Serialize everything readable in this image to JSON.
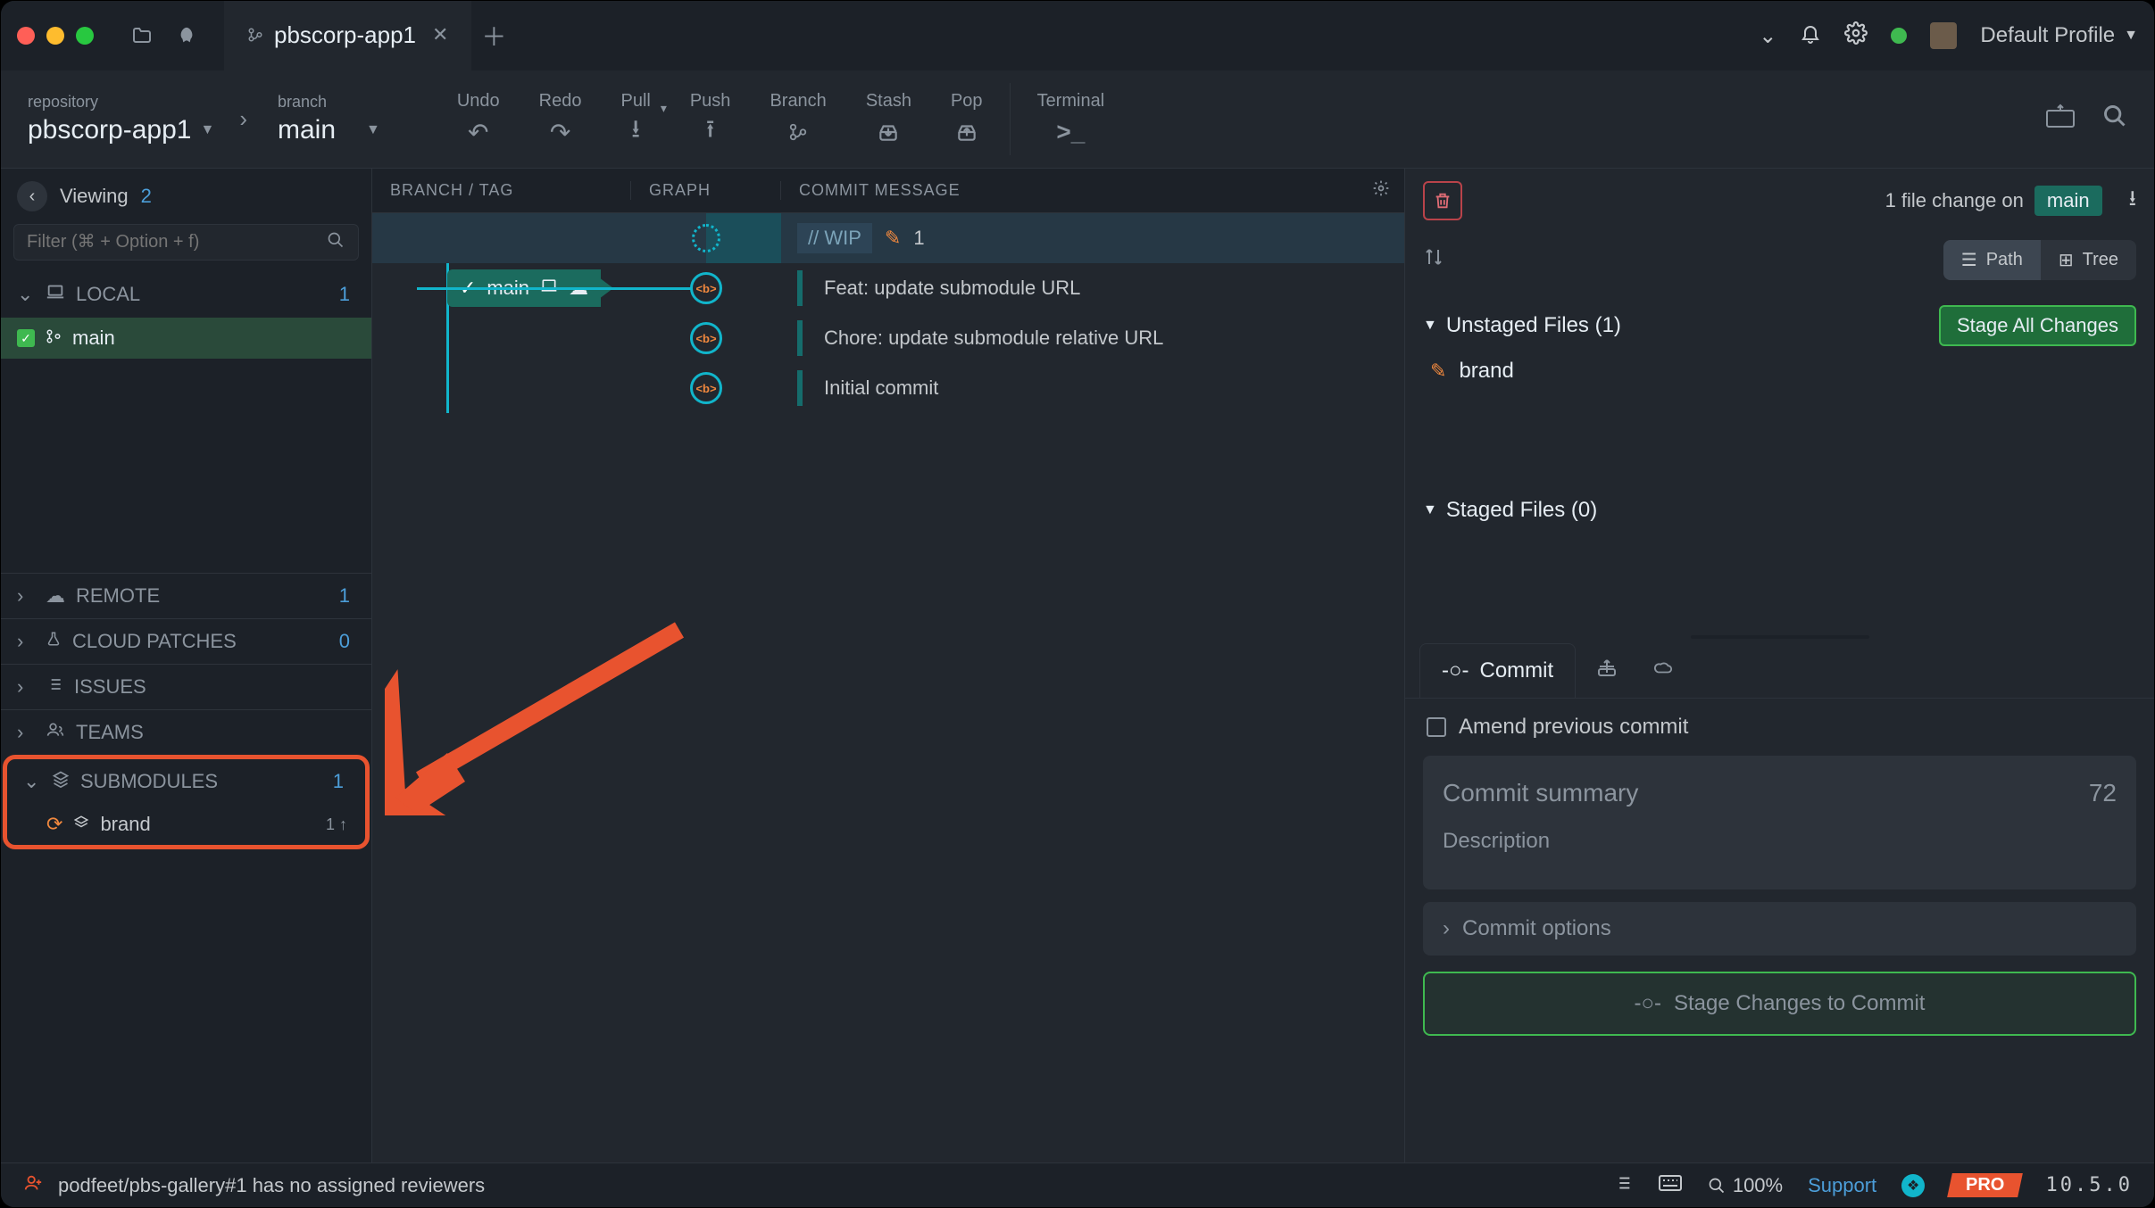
{
  "titlebar": {
    "tab_label": "pbscorp-app1",
    "profile_label": "Default Profile"
  },
  "toolbar": {
    "repo_label": "repository",
    "repo_value": "pbscorp-app1",
    "branch_label": "branch",
    "branch_value": "main",
    "undo": "Undo",
    "redo": "Redo",
    "pull": "Pull",
    "push": "Push",
    "branch": "Branch",
    "stash": "Stash",
    "pop": "Pop",
    "terminal": "Terminal"
  },
  "sidebar": {
    "viewing_label": "Viewing",
    "viewing_count": "2",
    "filter_placeholder": "Filter (⌘ + Option + f)",
    "local_label": "LOCAL",
    "local_count": "1",
    "main_branch": "main",
    "remote_label": "REMOTE",
    "remote_count": "1",
    "cloud_label": "CLOUD PATCHES",
    "cloud_count": "0",
    "issues_label": "ISSUES",
    "teams_label": "TEAMS",
    "submodules_label": "SUBMODULES",
    "submodules_count": "1",
    "submodule_item": "brand",
    "submodule_badge": "1 ↑"
  },
  "graph": {
    "hdr_branch": "BRANCH / TAG",
    "hdr_graph": "GRAPH",
    "hdr_msg": "COMMIT MESSAGE",
    "wip_label": "// WIP",
    "wip_count": "1",
    "main_chip": "main",
    "commit1": "Feat: update submodule URL",
    "commit2": "Chore: update submodule relative URL",
    "commit3": "Initial commit"
  },
  "right": {
    "file_change_text": "1 file change on",
    "branch_pill": "main",
    "path_btn": "Path",
    "tree_btn": "Tree",
    "unstaged_label": "Unstaged Files (1)",
    "stage_all": "Stage All Changes",
    "file_brand": "brand",
    "staged_label": "Staged Files (0)",
    "commit_tab": "Commit",
    "amend_label": "Amend previous commit",
    "summary_placeholder": "Commit summary",
    "summary_count": "72",
    "desc_placeholder": "Description",
    "commit_options": "Commit options",
    "stage_commit_btn": "Stage Changes to Commit"
  },
  "status": {
    "notice": "podfeet/pbs-gallery#1 has no assigned reviewers",
    "zoom": "100%",
    "support": "Support",
    "pro": "PRO",
    "version": "10.5.0"
  }
}
